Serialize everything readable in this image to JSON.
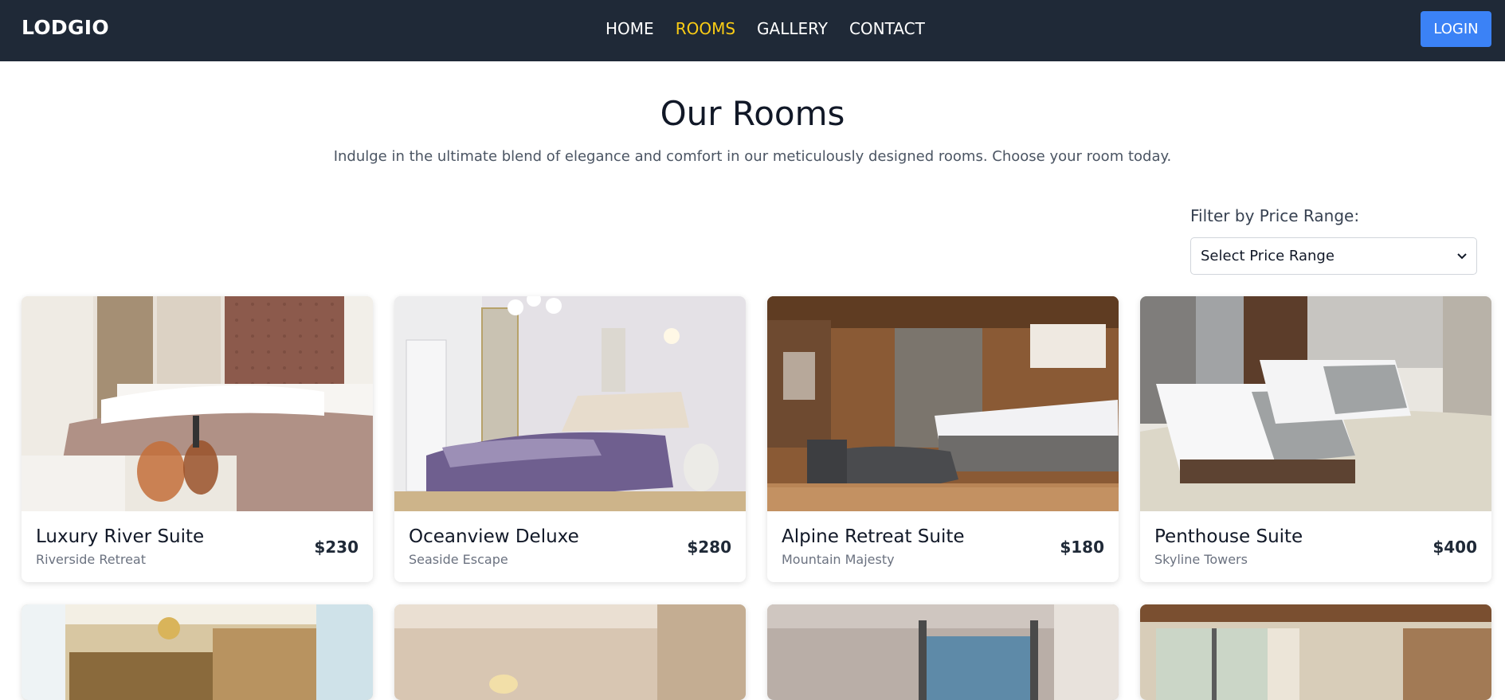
{
  "nav": {
    "brand": "LODGIO",
    "links": [
      "HOME",
      "ROOMS",
      "GALLERY",
      "CONTACT"
    ],
    "active_link": "ROOMS",
    "login_label": "LOGIN"
  },
  "hero": {
    "title": "Our Rooms",
    "subtitle": "Indulge in the ultimate blend of elegance and comfort in our meticulously designed rooms. Choose your room today."
  },
  "filter": {
    "label": "Filter by Price Range:",
    "selected": "Select Price Range"
  },
  "rooms": [
    {
      "name": "Luxury River Suite",
      "location": "Riverside Retreat",
      "price": "$230"
    },
    {
      "name": "Oceanview Deluxe",
      "location": "Seaside Escape",
      "price": "$280"
    },
    {
      "name": "Alpine Retreat Suite",
      "location": "Mountain Majesty",
      "price": "$180"
    },
    {
      "name": "Penthouse Suite",
      "location": "Skyline Towers",
      "price": "$400"
    }
  ],
  "colors": {
    "navbar_bg": "#1f2937",
    "active_link": "#facc15",
    "login_bg": "#3b82f6"
  }
}
